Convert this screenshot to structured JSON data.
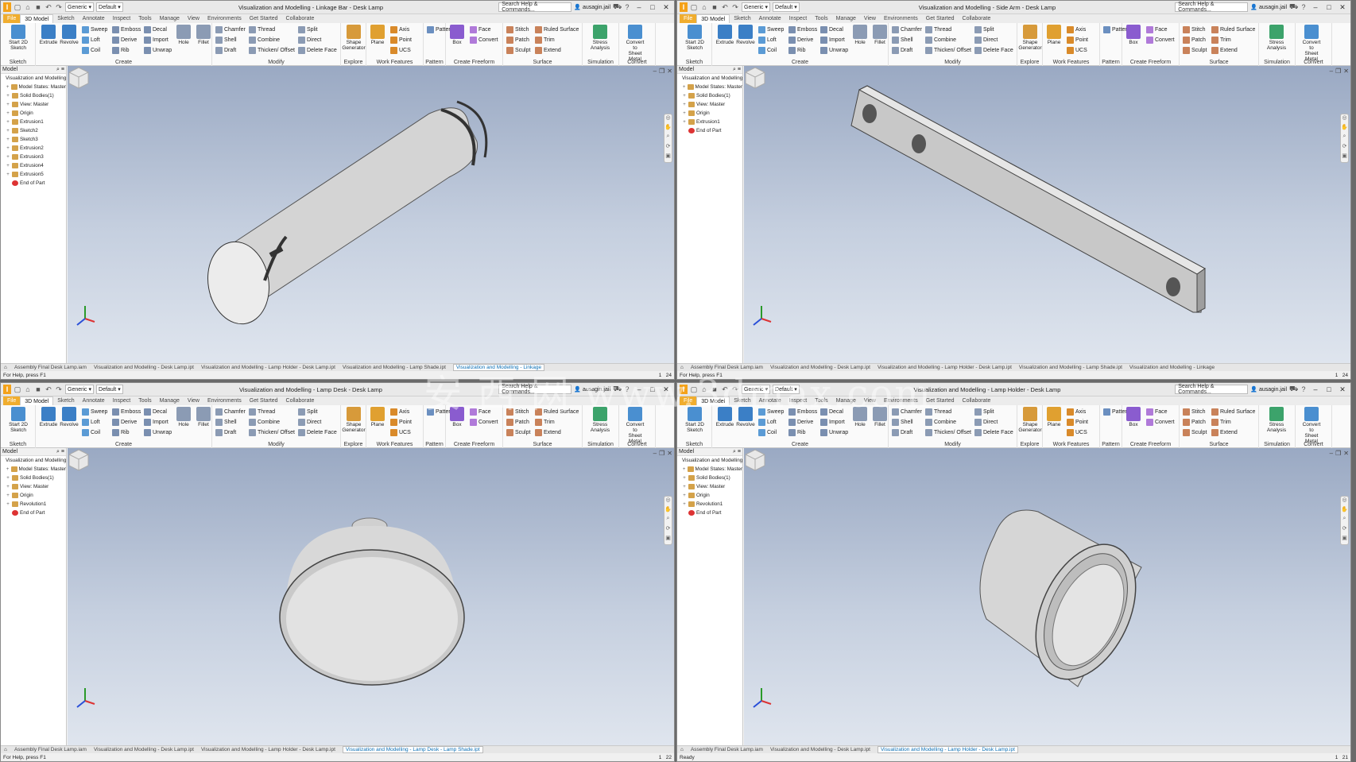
{
  "shared": {
    "style_combo": "Generic",
    "appearance_combo": "Default",
    "search_placeholder": "Search Help & Commands...",
    "user": "ausagin.jail",
    "tabs": [
      "File",
      "3D Model",
      "Sketch",
      "Annotate",
      "Inspect",
      "Tools",
      "Manage",
      "View",
      "Environments",
      "Get Started",
      "Collaborate"
    ],
    "ribbon": {
      "sketch_panel": "Sketch",
      "start_sketch": "Start 2D Sketch",
      "create_panel": "Create",
      "extrude": "Extrude",
      "revolve": "Revolve",
      "sweep": "Sweep",
      "emboss": "Emboss",
      "decal": "Decal",
      "loft": "Loft",
      "derive": "Derive",
      "import": "Import",
      "coil": "Coil",
      "rib": "Rib",
      "unwrap": "Unwrap",
      "hole": "Hole",
      "fillet": "Fillet",
      "modify_panel": "Modify",
      "chamfer": "Chamfer",
      "thread": "Thread",
      "split": "Split",
      "shell": "Shell",
      "combine": "Combine",
      "direct": "Direct",
      "draft": "Draft",
      "thicken": "Thicken/ Offset",
      "delete_face": "Delete Face",
      "explore_panel": "Explore",
      "shape_generator": "Shape Generator",
      "work_panel": "Work Features",
      "plane": "Plane",
      "axis": "Axis",
      "point": "Point",
      "ucs": "UCS",
      "pattern_panel": "Pattern",
      "freeform_panel": "Create Freeform",
      "box": "Box",
      "face": "Face",
      "convert": "Convert",
      "surface_panel": "Surface",
      "stitch": "Stitch",
      "ruled_surface": "Ruled Surface",
      "patch": "Patch",
      "trim": "Trim",
      "sculpt": "Sculpt",
      "extend": "Extend",
      "simulation_panel": "Simulation",
      "stress_analysis": "Stress Analysis",
      "convert_panel": "Convert",
      "convert_sheet": "Convert to Sheet Metal"
    },
    "browser_header": "Model",
    "doc_tabs": [
      "Assembly Final Desk Lamp.iam",
      "Visualization and Modelling - Desk Lamp.ipt",
      "Visualization and Modelling - Lamp Holder - Desk Lamp.ipt",
      "Visualization and Modelling - Lamp Shade.ipt",
      "Visualization and Modelling - Linkage"
    ]
  },
  "windows": [
    {
      "title": "Visualization and Modelling - Linkage Bar - Desk Lamp",
      "browser": [
        "Visualization and Modelling",
        "Model States: Master",
        "Solid Bodies(1)",
        "View: Master",
        "Origin",
        "Extrusion1",
        "Sketch2",
        "Sketch3",
        "Extrusion2",
        "Extrusion3",
        "Extrusion4",
        "Extrusion5",
        "End of Part"
      ],
      "doc_tabs": [
        "Assembly Final Desk Lamp.iam",
        "Visualization and Modelling - Desk Lamp.ipt",
        "Visualization and Modelling - Lamp Holder - Desk Lamp.ipt",
        "Visualization and Modelling - Lamp Shade.ipt",
        "Visualization and Modelling - Linkage"
      ],
      "active_tab": 4,
      "status_left": "For Help, press F1",
      "status_right": [
        "1",
        "24"
      ]
    },
    {
      "title": "Visualization and Modelling - Side Arm - Desk Lamp",
      "browser": [
        "Visualization and Modelling",
        "Model States: Master",
        "Solid Bodies(1)",
        "View: Master",
        "Origin",
        "Extrusion1",
        "End of Part"
      ],
      "doc_tabs": [
        "Assembly Final Desk Lamp.iam",
        "Visualization and Modelling - Desk Lamp.ipt",
        "Visualization and Modelling - Lamp Holder - Desk Lamp.ipt",
        "Visualization and Modelling - Lamp Shade.ipt",
        "Visualization and Modelling - Linkage"
      ],
      "active_tab": -1,
      "status_left": "For Help, press F1",
      "status_right": [
        "1",
        "24"
      ]
    },
    {
      "title": "Visualization and Modelling - Lamp Desk - Desk Lamp",
      "browser": [
        "Visualization and Modelling",
        "Model States: Master",
        "Solid Bodies(1)",
        "View: Master",
        "Origin",
        "Revolution1",
        "End of Part"
      ],
      "doc_tabs": [
        "Assembly Final Desk Lamp.iam",
        "Visualization and Modelling - Desk Lamp.ipt",
        "Visualization and Modelling - Lamp Holder - Desk Lamp.ipt",
        "Visualization and Modelling - Lamp Desk - Lamp Shade.ipt"
      ],
      "active_tab": 3,
      "status_left": "For Help, press F1",
      "status_right": [
        "1",
        "22"
      ]
    },
    {
      "title": "Visualization and Modelling - Lamp Holder - Desk Lamp",
      "browser": [
        "Visualization and Modelling",
        "Model States: Master",
        "Solid Bodies(1)",
        "View: Master",
        "Origin",
        "Revolution1",
        "End of Part"
      ],
      "doc_tabs": [
        "Assembly Final Desk Lamp.iam",
        "Visualization and Modelling - Desk Lamp.ipt",
        "Visualization and Modelling - Lamp Holder - Desk Lamp.ipt"
      ],
      "active_tab": 2,
      "status_left": "Ready",
      "status_right": [
        "1",
        "21"
      ]
    }
  ],
  "watermark": "安 西 网 www.3dmax.com"
}
